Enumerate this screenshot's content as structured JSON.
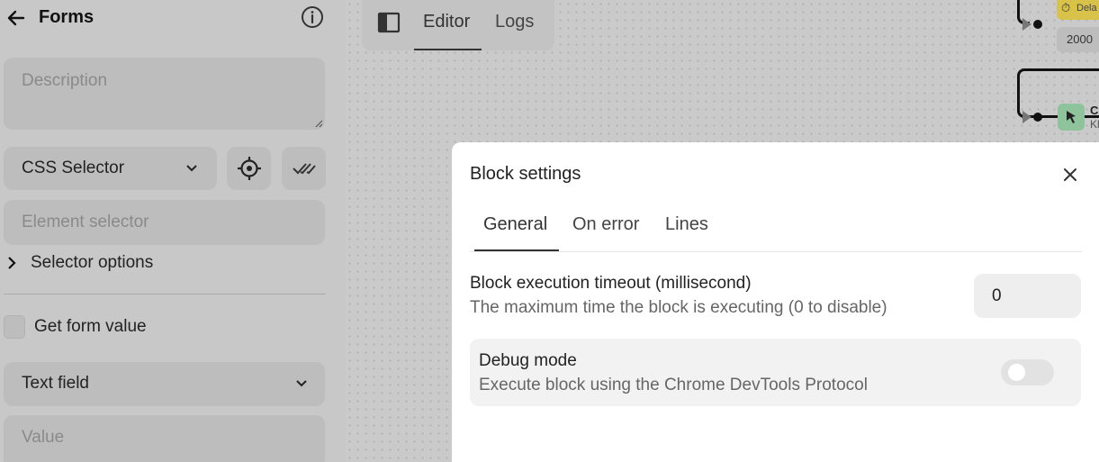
{
  "sidebar": {
    "title": "Forms",
    "description_placeholder": "Description",
    "selector_type": "CSS Selector",
    "element_selector_placeholder": "Element selector",
    "selector_options_label": "Selector options",
    "get_form_value_label": "Get form value",
    "field_type": "Text field",
    "value_placeholder": "Value"
  },
  "topbar": {
    "tabs": [
      "Editor",
      "Logs"
    ],
    "active_tab": "Editor"
  },
  "canvas": {
    "delay_node_label": "Dela",
    "delay_value": "2000",
    "click_node_title": "C",
    "click_node_subtitle": "Kl"
  },
  "modal": {
    "title": "Block settings",
    "tabs": [
      "General",
      "On error",
      "Lines"
    ],
    "active_tab": "General",
    "timeout": {
      "title": "Block execution timeout (millisecond)",
      "description": "The maximum time the block is executing (0 to disable)",
      "value": "0"
    },
    "debug": {
      "title": "Debug mode",
      "description": "Execute block using the Chrome DevTools Protocol",
      "enabled": false
    }
  },
  "colors": {
    "overlay_gray": "#c8c8c8",
    "modal_bg": "#ffffff",
    "delay_node": "#d8c24a",
    "click_node": "#8fc39b"
  }
}
